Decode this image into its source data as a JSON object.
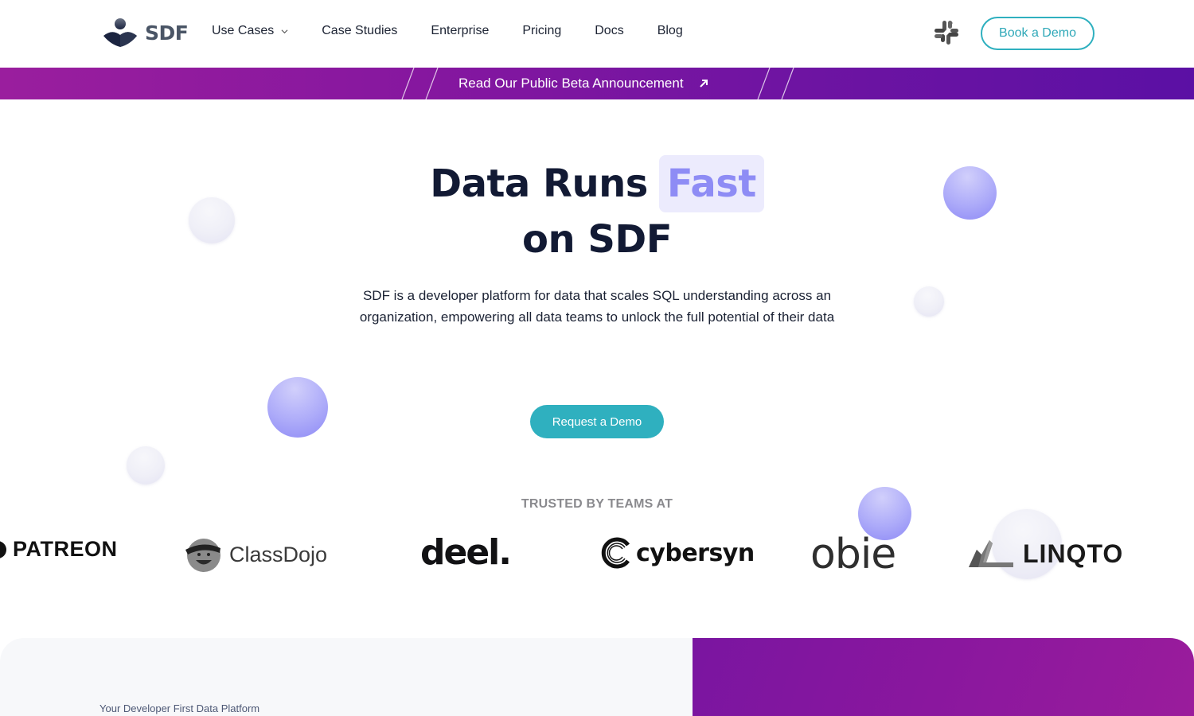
{
  "header": {
    "brand": "SDF",
    "nav": [
      {
        "label": "Use Cases",
        "has_dropdown": true
      },
      {
        "label": "Case Studies"
      },
      {
        "label": "Enterprise"
      },
      {
        "label": "Pricing"
      },
      {
        "label": "Docs"
      },
      {
        "label": "Blog"
      }
    ],
    "slack_icon": "slack-icon",
    "cta_label": "Book a Demo"
  },
  "banner": {
    "label": "Read Our Public Beta Announcement",
    "icon": "arrow-up-right-icon"
  },
  "hero": {
    "title_part1": "Data Runs",
    "title_highlight": "Fast",
    "title_part2": "on SDF",
    "subtitle": "SDF is a developer platform for data that scales SQL understanding across an organization, empowering all data teams to unlock the full potential of their data",
    "cta_label": "Request a Demo"
  },
  "trusted": {
    "heading": "TRUSTED BY TEAMS AT",
    "logos": [
      "PATREON",
      "ClassDojo",
      "deel.",
      "cybersyn",
      "obie",
      "LINQTO"
    ]
  },
  "bottom": {
    "tagline": "Your Developer First Data Platform"
  },
  "colors": {
    "accent_teal": "#2fb0bf",
    "highlight_purple": "#8e8cf5",
    "highlight_bg": "#ecebfd",
    "banner_start": "#9a1e9e",
    "banner_end": "#5b10a4",
    "heading_navy": "#121a34"
  }
}
